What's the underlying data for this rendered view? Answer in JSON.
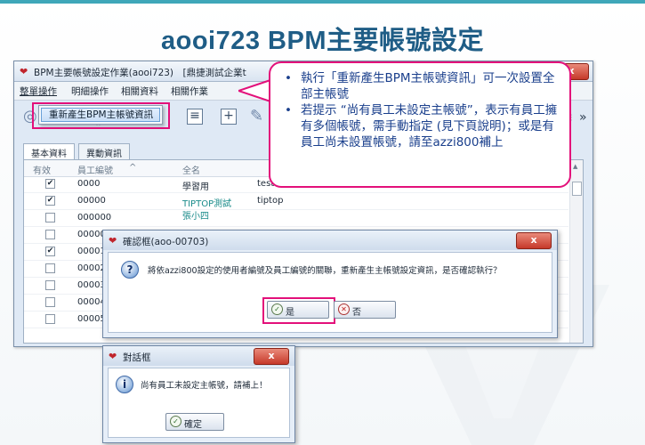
{
  "slide": {
    "title": "aooi723 BPM主要帳號設定"
  },
  "main_window": {
    "title": "BPM主要帳號設定作業(aooi723)　[鼎捷測試企業t",
    "close_label": "x",
    "menu": [
      "整單操作",
      "明細操作",
      "相關資料",
      "相關作業"
    ],
    "dropdown_item": "重新產生BPM主帳號資訊",
    "tabs": [
      "基本資料",
      "異動資訊"
    ],
    "grid_headers": [
      "有效",
      "員工編號",
      "全名"
    ],
    "rows": [
      {
        "checked": true,
        "emp_no": "0000",
        "full_name": "學習用",
        "extra": "tester"
      },
      {
        "checked": true,
        "emp_no": "00000",
        "full_name": "TIPTOP測試",
        "extra": "tiptop"
      },
      {
        "checked": false,
        "emp_no": "000000",
        "full_name": "張小四",
        "extra": ""
      },
      {
        "checked": false,
        "emp_no": "00000",
        "full_name": "",
        "extra": ""
      },
      {
        "checked": true,
        "emp_no": "00001",
        "full_name": "",
        "extra": ""
      },
      {
        "checked": false,
        "emp_no": "00002",
        "full_name": "",
        "extra": ""
      },
      {
        "checked": false,
        "emp_no": "00003",
        "full_name": "",
        "extra": ""
      },
      {
        "checked": false,
        "emp_no": "00004",
        "full_name": "",
        "extra": ""
      },
      {
        "checked": false,
        "emp_no": "00005",
        "full_name": "",
        "extra": ""
      }
    ]
  },
  "callout": {
    "line1": "執行「重新產生BPM主帳號資訊」可一次設置全部主帳號",
    "line2": "若提示 “尚有員工未設定主帳號”，表示有員工擁有多個帳號，需手動指定 (見下頁說明)；或是有員工尚未設置帳號，請至azzi800補上"
  },
  "confirm_dialog": {
    "title": "確認框(aoo-00703)",
    "close_label": "x",
    "message": "將依azzi800設定的使用者編號及員工編號的關聯，重新產生主帳號設定資訊，是否確認執行？",
    "yes_label": "是",
    "no_label": "否"
  },
  "notice_dialog": {
    "title": "對話框",
    "close_label": "x",
    "message": "尚有員工未設定主帳號，請補上！",
    "ok_label": "確定"
  },
  "colors": {
    "accent": "#e3107a",
    "title": "#1f5d86",
    "callout_text": "#1a3f8c"
  }
}
